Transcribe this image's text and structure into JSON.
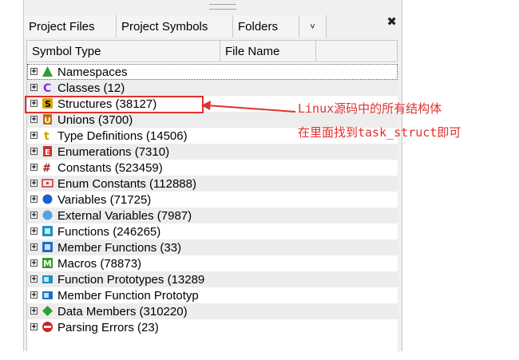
{
  "window": {
    "tabs": [
      "Project Files",
      "Project Symbols",
      "Folders"
    ],
    "more_tabs_glyph": "˅",
    "close_glyph": "✖"
  },
  "columns": {
    "symbol_type": "Symbol Type",
    "file_name": "File Name"
  },
  "expander_glyph": "+",
  "items": [
    {
      "label": "Namespaces",
      "icon": "namespace-icon",
      "color": "#2e9e2e"
    },
    {
      "label": "Classes (12)",
      "icon": "class-icon",
      "color": "#8a2be2"
    },
    {
      "label": "Structures (38127)",
      "icon": "structure-icon",
      "color": "#e0a000"
    },
    {
      "label": "Unions (3700)",
      "icon": "union-icon",
      "color": "#c07000"
    },
    {
      "label": "Type Definitions (14506)",
      "icon": "typedef-icon",
      "color": "#d4a000"
    },
    {
      "label": "Enumerations (7310)",
      "icon": "enumeration-icon",
      "color": "#d03030"
    },
    {
      "label": "Constants (523459)",
      "icon": "constant-icon",
      "color": "#a02020"
    },
    {
      "label": "Enum Constants (112888)",
      "icon": "enum-constant-icon",
      "color": "#d03030"
    },
    {
      "label": "Variables (71725)",
      "icon": "variable-icon",
      "color": "#1e5fd0"
    },
    {
      "label": "External Variables (7987)",
      "icon": "external-variable-icon",
      "color": "#5aa0e0"
    },
    {
      "label": "Functions (246265)",
      "icon": "function-icon",
      "color": "#1e90c0"
    },
    {
      "label": "Member Functions (33)",
      "icon": "member-function-icon",
      "color": "#1e70c0"
    },
    {
      "label": "Macros (78873)",
      "icon": "macro-icon",
      "color": "#2e9e2e"
    },
    {
      "label": "Function Prototypes (13289",
      "icon": "function-prototype-icon",
      "color": "#1e90c0"
    },
    {
      "label": "Member Function Prototyp",
      "icon": "member-function-prototype-icon",
      "color": "#1e70c0"
    },
    {
      "label": "Data Members (310220)",
      "icon": "data-member-icon",
      "color": "#2ea02e"
    },
    {
      "label": "Parsing Errors (23)",
      "icon": "parsing-error-icon",
      "color": "#d02020"
    }
  ],
  "annotation": {
    "line1": "Linux源码中的所有结构体",
    "line2": "在里面找到task_struct即可",
    "color": "#e0312f"
  }
}
